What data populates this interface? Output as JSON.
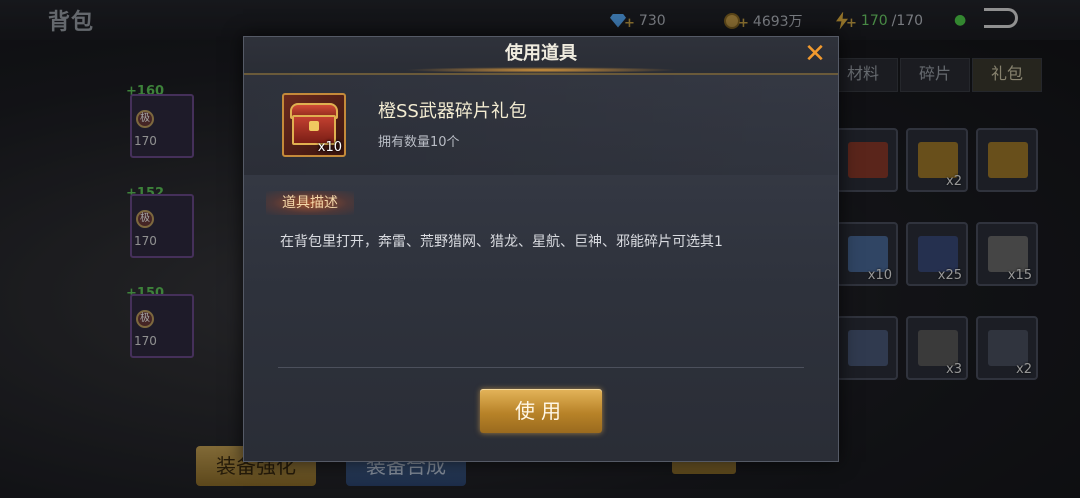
{
  "background": {
    "bag_title": "背包",
    "currency": {
      "gems": "730",
      "gold": "4693万",
      "energy_current": "170",
      "energy_max": "/170"
    },
    "tabs": [
      {
        "label": "材料"
      },
      {
        "label": "碎片"
      },
      {
        "label": "礼包"
      }
    ],
    "left_items": [
      {
        "plus": "+160",
        "level": "170"
      },
      {
        "plus": "+152",
        "level": "170"
      },
      {
        "plus": "+150",
        "level": "170"
      }
    ],
    "grid_counts": [
      "",
      "x2",
      "",
      "x10",
      "x25",
      "x15",
      "",
      "x3",
      "x2"
    ],
    "badge_text": "极",
    "bottom_buttons": {
      "enhance": "装备强化",
      "combine": "装备合成"
    }
  },
  "modal": {
    "title": "使用道具",
    "close_icon": "close-icon",
    "item": {
      "name": "橙SS武器碎片礼包",
      "quantity_badge": "x10",
      "owned": "拥有数量10个",
      "icon": "treasure-chest-icon"
    },
    "description_label": "道具描述",
    "description": "在背包里打开，奔雷、荒野猎网、猎龙、星航、巨神、邪能碎片可选其1",
    "use_button": "使用",
    "colors": {
      "accent": "#f29a2e",
      "button": "#c99236",
      "quality_orange": "#c48a3a"
    }
  }
}
